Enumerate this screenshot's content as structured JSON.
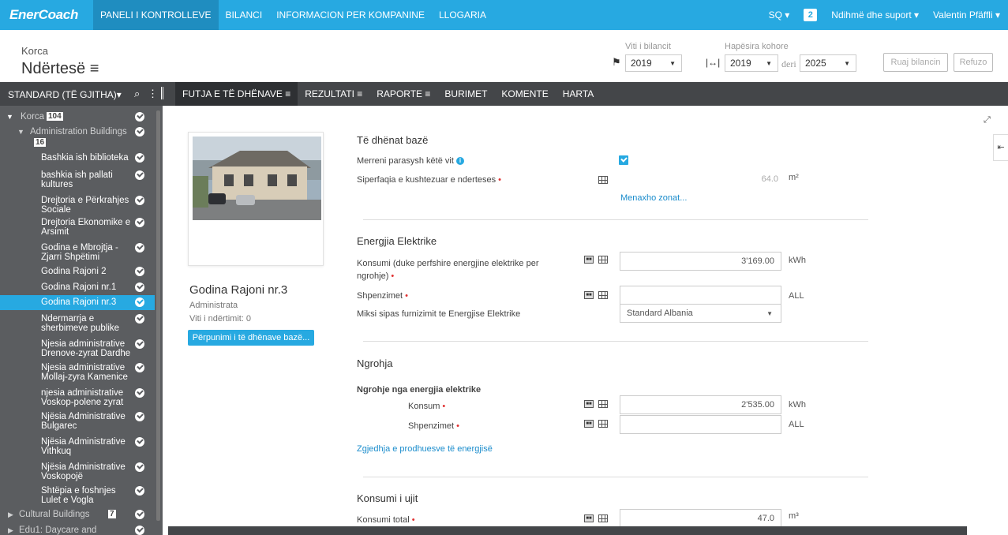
{
  "app": {
    "logo": "EnerCoach"
  },
  "topnav": [
    "PANELI I KONTROLLEVE",
    "BILANCI",
    "INFORMACION PER KOMPANINE",
    "LLOGARIA"
  ],
  "topright": {
    "lang": "SQ ▾",
    "notif": "2",
    "help": "Ndihmë dhe suport ▾",
    "user": "Valentin Pfäffli ▾"
  },
  "header": {
    "location_small": "Korca",
    "location_big": "Ndërtesë ≡",
    "year_label": "Viti i bilancit",
    "year_value": "2019",
    "period_label": "Hapësira kohore",
    "period_from": "2019",
    "period_to_label": "deri",
    "period_to": "2025",
    "save_btn": "Ruaj bilancin",
    "reject_btn": "Refuzo"
  },
  "tabbar": {
    "filter": "STANDARD (TË GJITHA)▾",
    "tabs": [
      "FUTJA E TË DHËNAVE ≡",
      "REZULTATI ≡",
      "RAPORTE ≡",
      "BURIMET",
      "KOMENTE",
      "HARTA"
    ]
  },
  "sidebar": {
    "root": "Korca",
    "root_count": "104",
    "group": "Administration Buildings",
    "group_count": "16",
    "items": [
      "Bashkia ish biblioteka",
      "bashkia ish pallati kultures",
      "Drejtoria e Përkrahjes Sociale",
      "Drejtoria Ekonomike e Arsimit",
      "Godina e Mbrojtja - Zjarri Shpëtimi",
      "Godina Rajoni 2",
      "Godina Rajoni nr.1",
      "Godina Rajoni nr.3",
      "Ndermarrja e sherbimeve publike",
      "Njesia administrative Drenove-zyrat Dardhe",
      "Njesia administrative Mollaj-zyra Kamenice",
      "njesia administrative Voskop-polene zyrat",
      "Njësia Administrative Bulgarec",
      "Njësia Administrative Vithkuq",
      "Njësia Administrative Voskopojë",
      "Shtëpia e foshnjes Lulet e Vogla"
    ],
    "cultural": "Cultural Buildings",
    "cultural_count": "7",
    "edu": "Edu1: Daycare and"
  },
  "building": {
    "name": "Godina Rajoni nr.3",
    "type": "Administrata",
    "year": "Viti i ndërtimit: 0",
    "edit_btn": "Përpunimi i të dhënave bazë..."
  },
  "form": {
    "base_title": "Të dhënat bazë",
    "consider_label": "Merreni parasysh këtë vit",
    "area_label": "Siperfaqia e kushtezuar e nderteses",
    "area_value": "64.0",
    "area_unit": "m²",
    "zones_link": "Menaxho zonat...",
    "elec_title": "Energjia Elektrike",
    "elec_cons_label": "Konsumi (duke perfshire energjine elektrike per ngrohje)",
    "elec_cons_value": "3'169.00",
    "elec_cons_unit": "kWh",
    "elec_cost_label": "Shpenzimet",
    "elec_cost_unit": "ALL",
    "mix_label": "Miksi sipas furnizimit te Energjise Elektrike",
    "mix_value": "Standard Albania",
    "heat_title": "Ngrohja",
    "heat_sub": "Ngrohje nga energjia elektrike",
    "heat_cons_label": "Konsum",
    "heat_cons_value": "2'535.00",
    "heat_cons_unit": "kWh",
    "heat_cost_label": "Shpenzimet",
    "heat_cost_unit": "ALL",
    "producer_link": "Zgjedhja e prodhuesve të energjisë",
    "water_title": "Konsumi i ujit",
    "water_total_label": "Konsumi total",
    "water_total_value": "47.0",
    "water_unit": "m³"
  }
}
